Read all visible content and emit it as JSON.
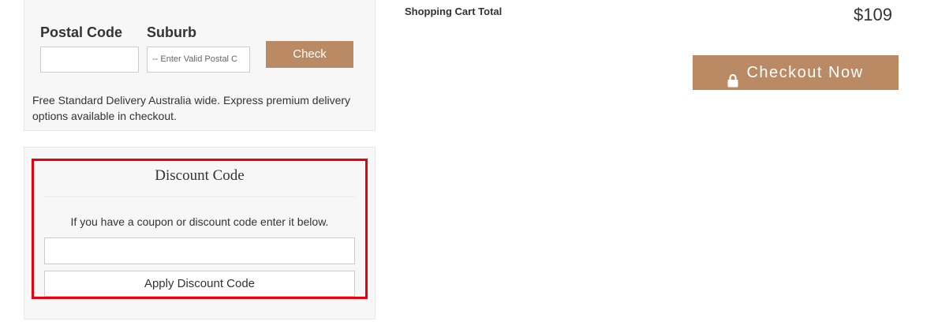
{
  "delivery": {
    "postal_code_label": "Postal Code",
    "postal_code_value": "",
    "suburb_label": "Suburb",
    "suburb_selected": "-- Enter Valid Postal C",
    "check_label": "Check",
    "note": "Free Standard Delivery Australia wide. Express premium delivery options available in checkout."
  },
  "discount": {
    "title": "Discount Code",
    "instructions": "If you have a coupon or discount code enter it below.",
    "input_value": "",
    "apply_label": "Apply Discount Code"
  },
  "cart": {
    "total_label": "Shopping Cart Total",
    "total_value": "$109",
    "checkout_label": "Checkout Now",
    "checkout_icon": "lock-icon"
  },
  "colors": {
    "accent": "#b98a63",
    "highlight_border": "#e8000d",
    "panel_bg": "#f7f7f7"
  }
}
